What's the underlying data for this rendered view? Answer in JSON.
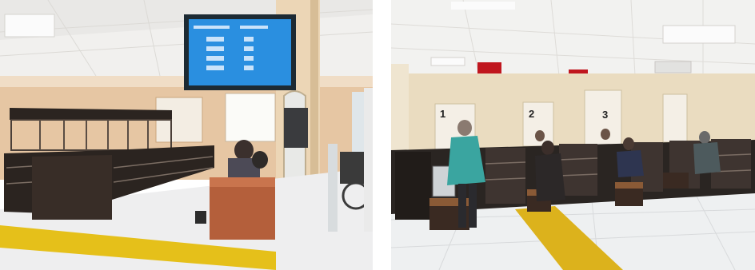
{
  "photos": [
    {
      "id": "left",
      "subject": "service-hall-waiting-area",
      "screen_lines": [
        "",
        "",
        "",
        "",
        ""
      ],
      "colors": {
        "wall": "#e9c9a6",
        "floor": "#efeff0",
        "tactile": "#e5c01a",
        "counter": "#2b2420",
        "chair": "#b45f3b",
        "screen": "#2a8fe0"
      }
    },
    {
      "id": "right",
      "subject": "service-counters-windows",
      "window_numbers": [
        "1",
        "2",
        "3"
      ],
      "colors": {
        "wall": "#eadcc0",
        "floor": "#eef0f1",
        "tactile": "#dcb21c",
        "counter": "#2a2522",
        "coat": "#3aa5a0",
        "led": "#c0161e"
      }
    }
  ]
}
